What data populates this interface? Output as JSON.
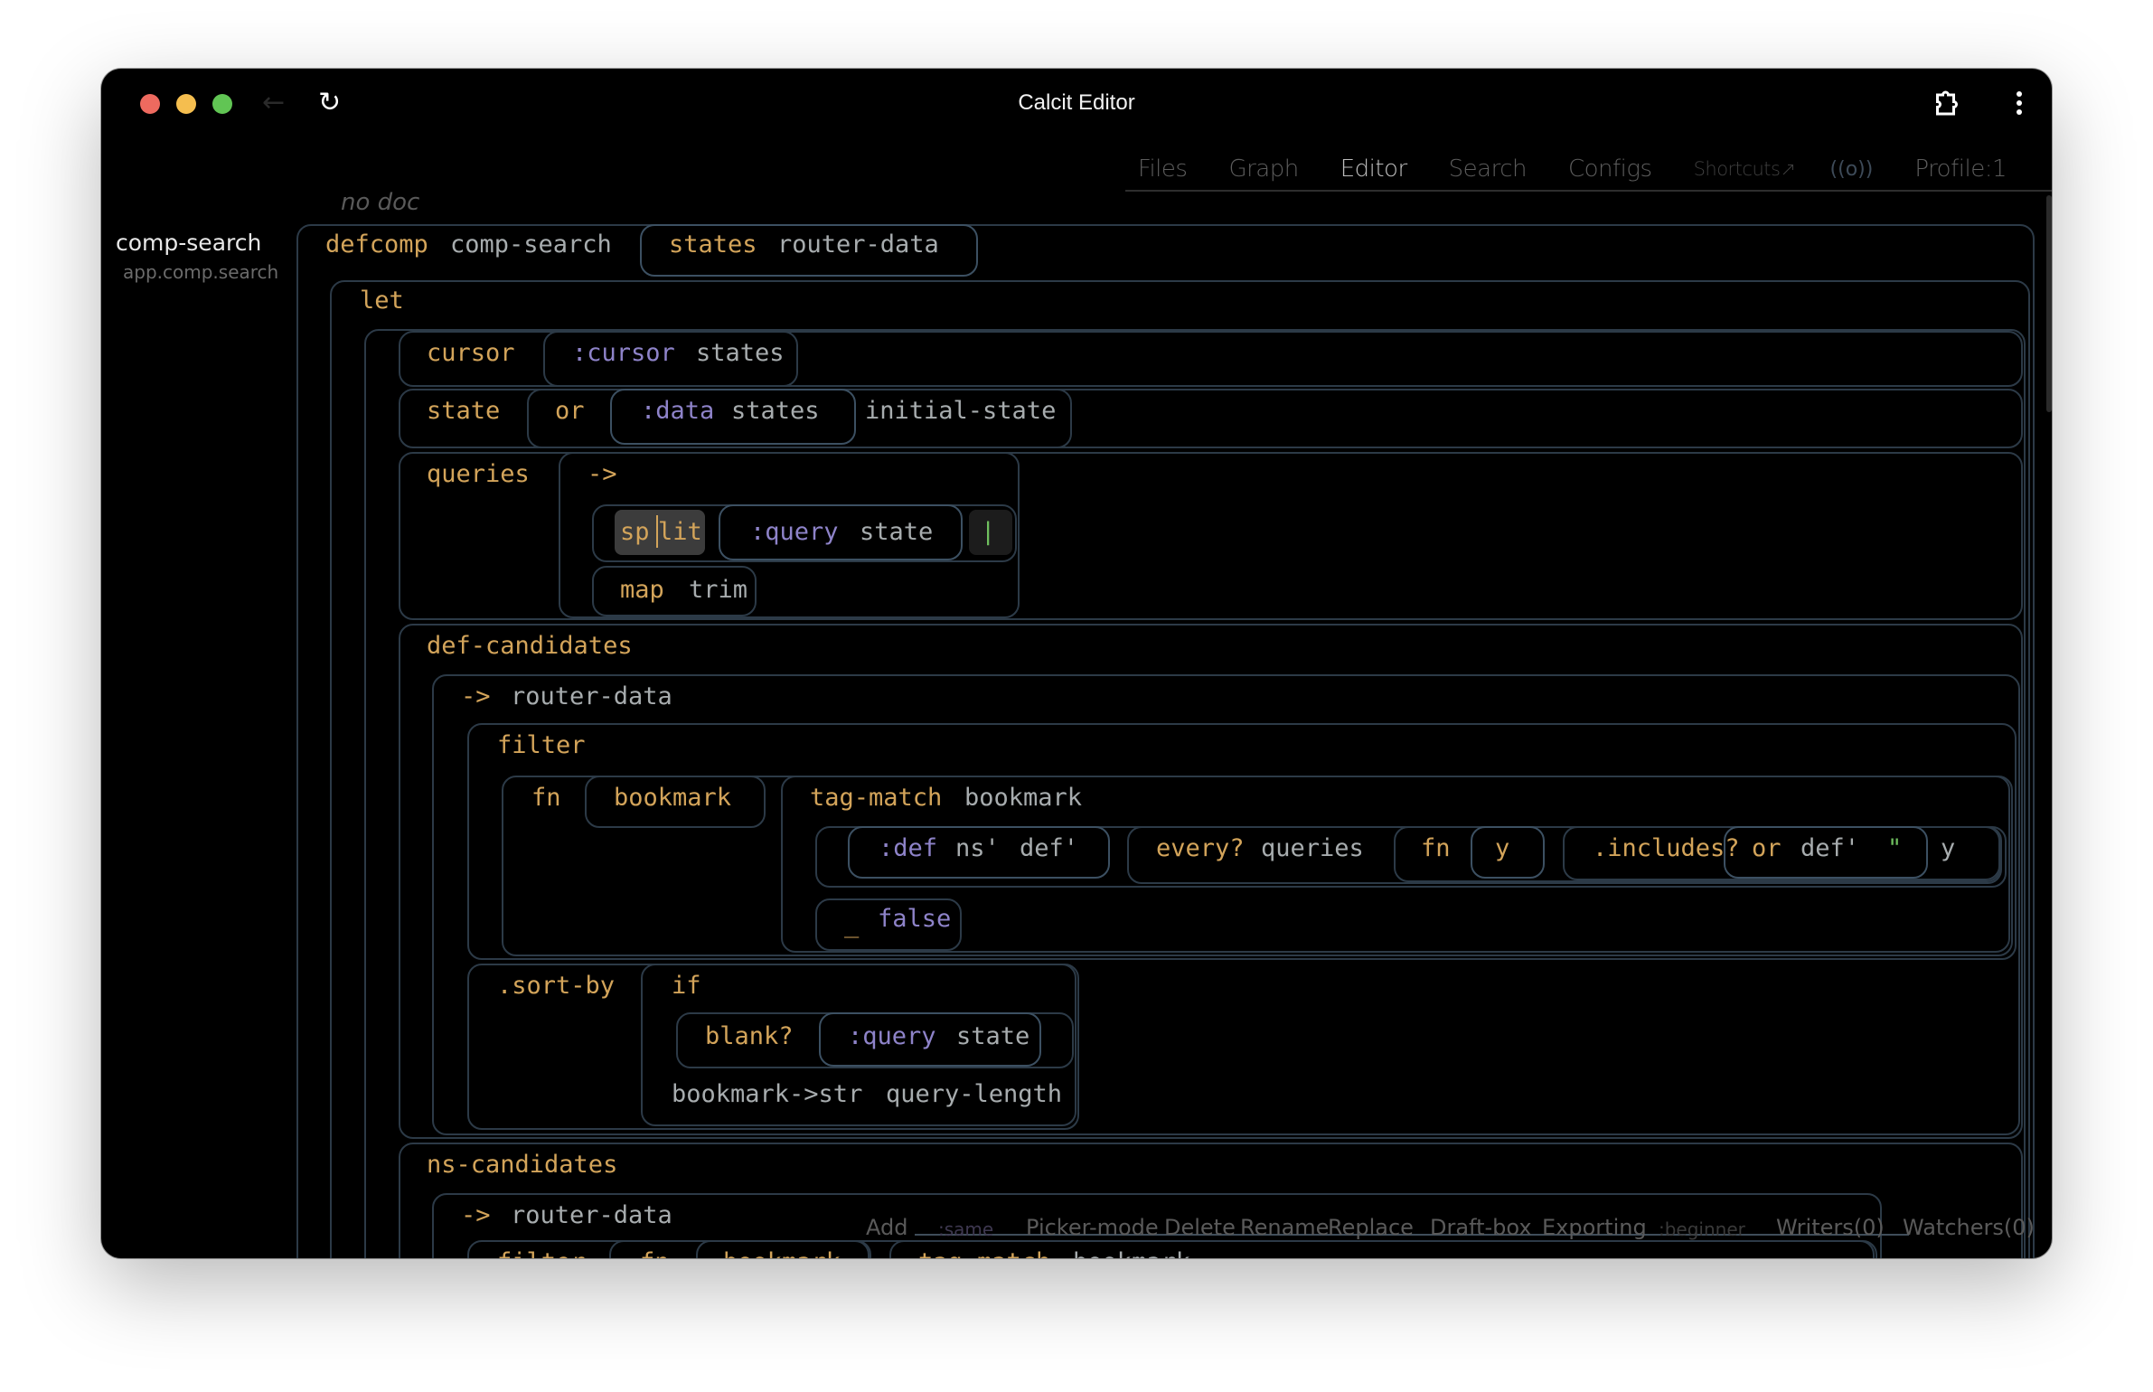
{
  "window": {
    "title": "Calcit Editor",
    "back_icon": "arrow-left-icon",
    "reload_icon": "reload-icon",
    "extension_icon": "puzzle-icon",
    "menu_icon": "kebab-menu-icon"
  },
  "nav": {
    "items": [
      {
        "label": "Files",
        "active": false
      },
      {
        "label": "Graph",
        "active": false
      },
      {
        "label": "Editor",
        "active": true
      },
      {
        "label": "Search",
        "active": false
      },
      {
        "label": "Configs",
        "active": false
      }
    ],
    "shortcuts": "Shortcuts↗",
    "broadcast_icon": "((o))",
    "profile": "Profile:1"
  },
  "sidebar": {
    "def_name": "comp-search",
    "namespace": "app.comp.search"
  },
  "editor": {
    "doc": "no doc",
    "code": {
      "defcomp": "defcomp",
      "name": "comp-search",
      "args_kw": "states",
      "args_sym": "router-data",
      "let": "let",
      "cursor": "cursor",
      "cursor_key": ":cursor",
      "cursor_src": "states",
      "state": "state",
      "or": "or",
      "data_key": ":data",
      "data_src": "states",
      "initial": "initial-state",
      "queries": "queries",
      "thread": "->",
      "split_a": "sp",
      "split_b": "lit",
      "query_key": ":query",
      "query_src": "state",
      "empty_str": "|",
      "map": "map",
      "trim": "trim",
      "def_candidates": "def-candidates",
      "thread2": "->",
      "router_data": "router-data",
      "filter": "filter",
      "fn": "fn",
      "bookmark": "bookmark",
      "tag_match": "tag-match",
      "bookmark2": "bookmark",
      "def_key": ":def",
      "ns_prime": "ns'",
      "def_prime": "def'",
      "every": "every?",
      "queries2": "queries",
      "fn2": "fn",
      "y": "y",
      "includes": ".includes?",
      "or2": "or",
      "def_prime2": "def'",
      "dq": "\"",
      "y2": "y",
      "underscore": "_",
      "false": "false",
      "sort_by": ".sort-by",
      "if": "if",
      "blank": "blank?",
      "query_key2": ":query",
      "state2": "state",
      "bm_str": "bookmark->str",
      "qlen": "query-length",
      "ns_candidates": "ns-candidates",
      "thread3": "->",
      "router_data2": "router-data",
      "filter2": "filter",
      "fn3": "fn",
      "bookmark3": "bookmark",
      "tag_match2": "tag-match",
      "bookmark4": "bookmark"
    }
  },
  "bottombar": {
    "add": "Add",
    "same": ":same",
    "picker": "Picker-mode",
    "delete": "Delete",
    "rename": "Rename",
    "replace": "Replace",
    "draft": "Draft-box",
    "exporting": "Exporting",
    "beginner": ":beginner",
    "writers": "Writers(0)",
    "watchers": "Watchers(0)"
  },
  "colors": {
    "keyword": "#d3a45a",
    "symbol": "#a7acae",
    "tag": "#8e83c9",
    "string": "#6fbf5e",
    "border": "#2c3a47"
  }
}
